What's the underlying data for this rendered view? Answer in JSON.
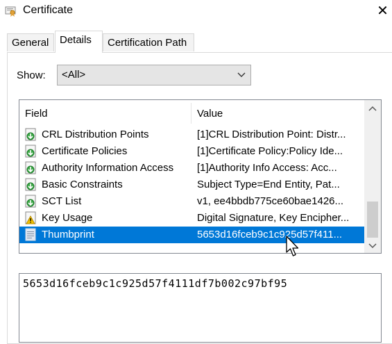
{
  "window": {
    "title": "Certificate",
    "close": "✕"
  },
  "tabs": [
    {
      "label": "General"
    },
    {
      "label": "Details"
    },
    {
      "label": "Certification Path"
    }
  ],
  "show": {
    "label": "Show:",
    "value": "<All>"
  },
  "list": {
    "columns": {
      "field": "Field",
      "value": "Value"
    },
    "rows": [
      {
        "field": "CRL Distribution Points",
        "value": "[1]CRL Distribution Point: Distr...",
        "icon": "green-arrow-doc-icon"
      },
      {
        "field": "Certificate Policies",
        "value": "[1]Certificate Policy:Policy Ide...",
        "icon": "green-arrow-doc-icon"
      },
      {
        "field": "Authority Information Access",
        "value": "[1]Authority Info Access: Acc...",
        "icon": "green-arrow-doc-icon"
      },
      {
        "field": "Basic Constraints",
        "value": "Subject Type=End Entity, Pat...",
        "icon": "green-arrow-doc-icon"
      },
      {
        "field": "SCT List",
        "value": "v1, ee4bbdb775ce60bae1426...",
        "icon": "green-arrow-doc-icon"
      },
      {
        "field": "Key Usage",
        "value": "Digital Signature, Key Encipher...",
        "icon": "warning-doc-icon"
      },
      {
        "field": "Thumbprint",
        "value": "5653d16fceb9c1c925d57f411...",
        "icon": "doc-icon",
        "selected": true
      }
    ]
  },
  "value_box": {
    "text": "5653d16fceb9c1c925d57f4111df7b002c97bf95"
  },
  "colors": {
    "selection": "#0078d7",
    "tab_border": "#d9d9d9"
  }
}
